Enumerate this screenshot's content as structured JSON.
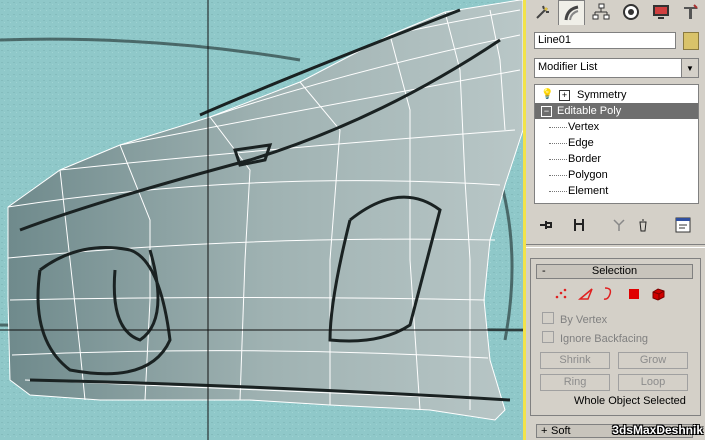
{
  "command_panel": {
    "tabs": [
      "create-icon",
      "modify-icon",
      "hierarchy-icon",
      "motion-icon",
      "display-icon",
      "utilities-icon"
    ],
    "object_name": "Line01",
    "object_color": "#d9c36a",
    "modifier_list": "Modifier List",
    "stack": {
      "items": [
        {
          "label": "Symmetry",
          "expand": "+"
        },
        {
          "label": "Editable Poly",
          "expand": "−"
        }
      ],
      "sub_objects": [
        "Vertex",
        "Edge",
        "Border",
        "Polygon",
        "Element"
      ]
    },
    "stack_tools": [
      "pin-stack-icon",
      "show-end-result-icon",
      "make-unique-icon",
      "remove-modifier-icon",
      "configure-sets-icon"
    ],
    "selection_rollout": {
      "collapse": "-",
      "title": "Selection",
      "levels": [
        "vertex-icon",
        "edge-icon",
        "border-icon",
        "polygon-icon",
        "element-icon"
      ],
      "by_vertex": "By Vertex",
      "ignore_backfacing": "Ignore Backfacing",
      "shrink": "Shrink",
      "grow": "Grow",
      "ring": "Ring",
      "loop": "Loop",
      "status": "Whole Object Selected"
    },
    "soft_selection": {
      "expand": "+",
      "title": "Soft"
    }
  },
  "watermark": "3dsMaxDeshnik"
}
